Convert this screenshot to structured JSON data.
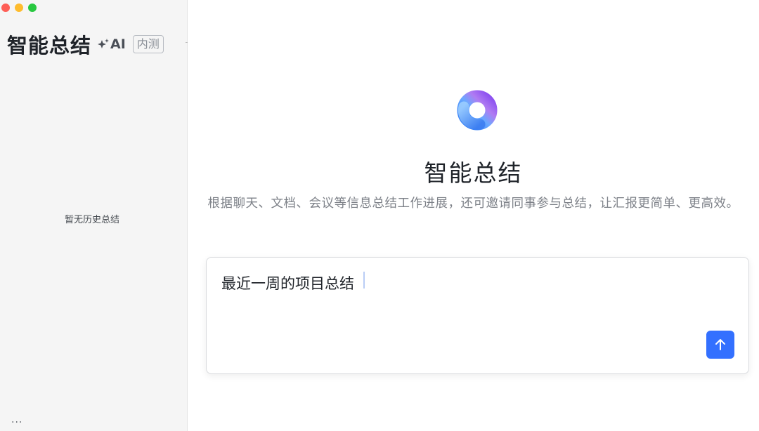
{
  "sidebar": {
    "title": "智能总结",
    "ai_label": "AI",
    "beta_badge": "内测",
    "empty_text": "暂无历史总结",
    "more": "···"
  },
  "main": {
    "title": "智能总结",
    "subtitle": "根据聊天、文档、会议等信息总结工作进展，还可邀请同事参与总结，让汇报更简单、更高效。",
    "input_value": "最近一周的项目总结"
  },
  "icons": {
    "logo": "gradient-ring-logo-icon",
    "sparkle": "sparkle-icon",
    "send": "arrow-up-icon"
  },
  "colors": {
    "accent": "#3370ff",
    "sidebar_bg": "#f5f5f5"
  }
}
